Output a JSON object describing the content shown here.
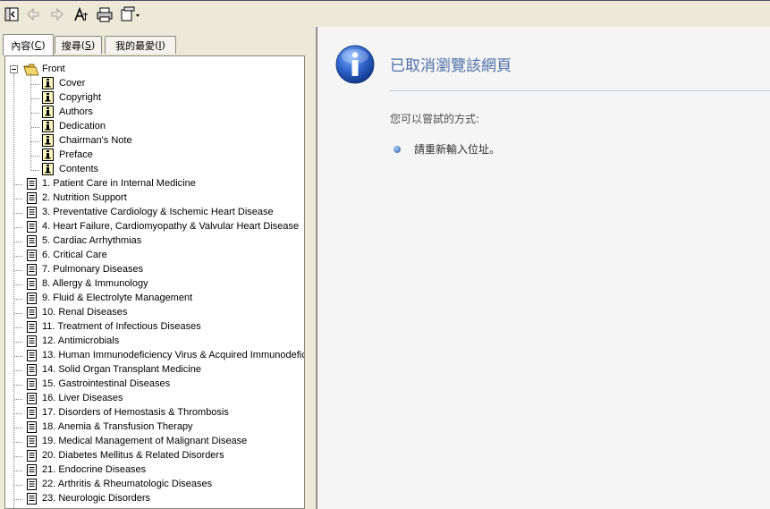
{
  "toolbar": {
    "buttons": [
      {
        "name": "hide-pane-button",
        "icon": "hide-pane-icon"
      },
      {
        "name": "back-button",
        "icon": "back-arrow-icon"
      },
      {
        "name": "forward-button",
        "icon": "forward-arrow-icon"
      },
      {
        "name": "font-button",
        "icon": "font-icon"
      },
      {
        "name": "print-button",
        "icon": "printer-icon"
      },
      {
        "name": "options-button",
        "icon": "options-icon"
      }
    ]
  },
  "tabs": [
    {
      "label": "內容",
      "key": "C"
    },
    {
      "label": "搜尋",
      "key": "S"
    },
    {
      "label": "我的最愛",
      "key": "I"
    }
  ],
  "tree": {
    "root": "Front",
    "front_children": [
      "Cover",
      "Copyright",
      "Authors",
      "Dedication",
      "Chairman's Note",
      "Preface",
      "Contents"
    ],
    "chapters": [
      "1. Patient Care in Internal Medicine",
      "2. Nutrition Support",
      "3. Preventative Cardiology & Ischemic Heart Disease",
      "4. Heart Failure, Cardiomyopathy & Valvular Heart Disease",
      "5. Cardiac Arrhythmias",
      "6. Critical Care",
      "7. Pulmonary Diseases",
      "8. Allergy & Immunology",
      "9. Fluid & Electrolyte Management",
      "10. Renal Diseases",
      "11. Treatment of Infectious Diseases",
      "12. Antimicrobials",
      "13. Human Immunodeficiency Virus & Acquired Immunodeficie",
      "14. Solid Organ Transplant Medicine",
      "15. Gastrointestinal Diseases",
      "16. Liver Diseases",
      "17. Disorders of Hemostasis & Thrombosis",
      "18. Anemia & Transfusion Therapy",
      "19. Medical Management of Malignant Disease",
      "20. Diabetes Mellitus & Related Disorders",
      "21. Endocrine Diseases",
      "22. Arthritis & Rheumatologic Diseases",
      "23. Neurologic Disorders"
    ]
  },
  "content": {
    "title": "已取消瀏覽該網頁",
    "subtitle": "您可以嘗試的方式:",
    "items": [
      "請重新輸入位址。"
    ]
  },
  "colors": {
    "title": "#4e6fa8",
    "accent": "#2a5caa",
    "folder": "#f2d66b"
  }
}
